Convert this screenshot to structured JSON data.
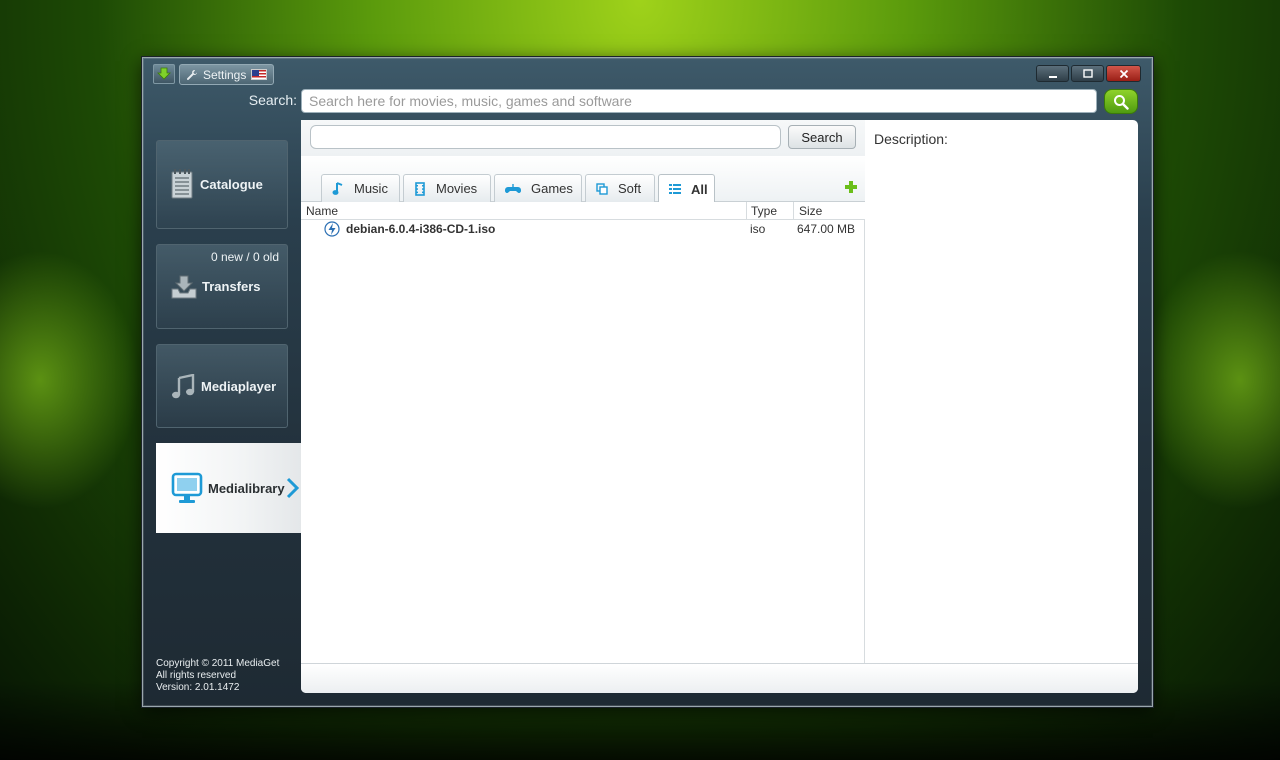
{
  "window": {
    "settings_label": "Settings"
  },
  "top_search": {
    "label": "Search:",
    "placeholder": "Search here for movies, music, games and software"
  },
  "sidebar": {
    "items": [
      {
        "label": "Catalogue",
        "icon": "catalogue-icon"
      },
      {
        "label": "Transfers",
        "icon": "download-tray-icon",
        "count": "0 new / 0 old"
      },
      {
        "label": "Mediaplayer",
        "icon": "music-note-icon"
      },
      {
        "label": "Medialibrary",
        "icon": "monitor-icon",
        "selected": true
      }
    ],
    "copyright": [
      "Copyright © 2011 MediaGet",
      "All rights reserved",
      "Version: 2.01.1472"
    ]
  },
  "library": {
    "search_button": "Search",
    "tabs": [
      {
        "label": "Music",
        "icon": "music-note-icon"
      },
      {
        "label": "Movies",
        "icon": "film-icon"
      },
      {
        "label": "Games",
        "icon": "gamepad-icon"
      },
      {
        "label": "Soft",
        "icon": "copy-icon"
      },
      {
        "label": "All",
        "icon": "list-icon",
        "active": true
      }
    ],
    "columns": [
      "Name",
      "Type",
      "Size"
    ],
    "rows": [
      {
        "name": "debian-6.0.4-i386-CD-1.iso",
        "type": "iso",
        "size": "647.00 MB",
        "icon": "torrent-bolt-icon"
      }
    ]
  },
  "description": {
    "label": "Description:"
  },
  "colors": {
    "accent_green": "#6bbf1a",
    "accent_blue": "#1e9ad6",
    "close_red": "#c0392b"
  }
}
